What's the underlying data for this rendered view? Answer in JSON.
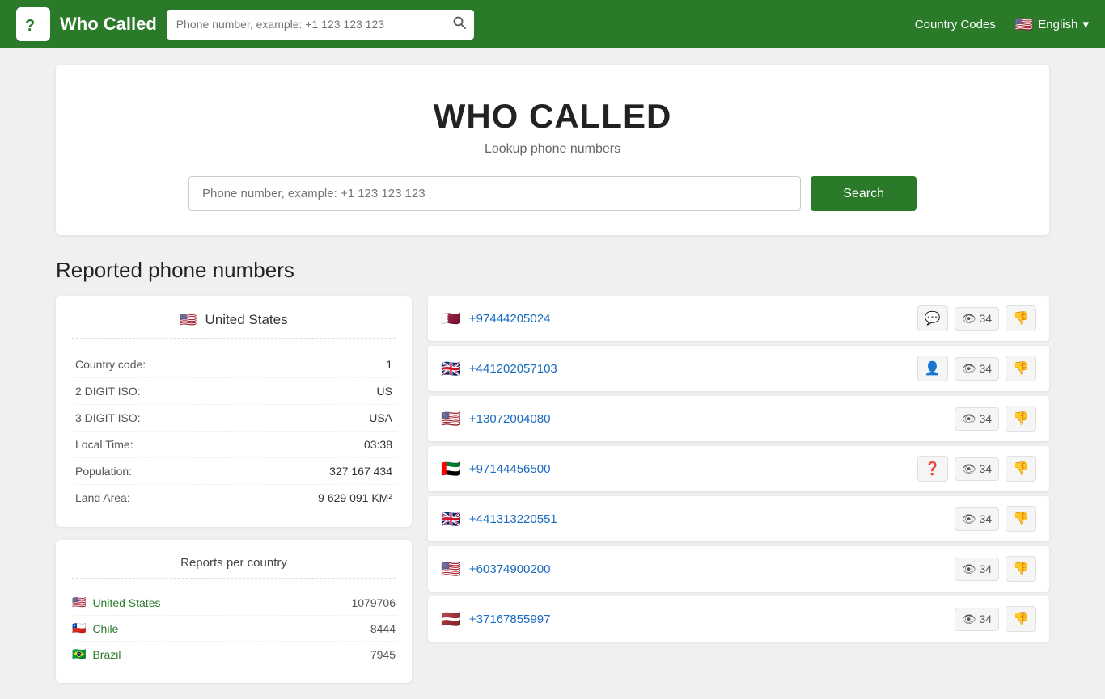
{
  "site": {
    "name": "Who Called",
    "logo_symbol": "?",
    "tagline": "Lookup phone numbers"
  },
  "navbar": {
    "search_placeholder": "Phone number, example: +1 123 123 123",
    "country_codes_label": "Country Codes",
    "language_label": "English",
    "language_flag": "🇺🇸"
  },
  "hero": {
    "title": "WHO CALLED",
    "subtitle": "Lookup phone numbers",
    "search_placeholder": "Phone number, example: +1 123 123 123",
    "search_button": "Search"
  },
  "section": {
    "reported_title": "Reported phone numbers"
  },
  "country_info": {
    "name": "United States",
    "flag": "🇺🇸",
    "country_code_label": "Country code:",
    "country_code_value": "1",
    "iso2_label": "2 DIGIT ISO:",
    "iso2_value": "US",
    "iso3_label": "3 DIGIT ISO:",
    "iso3_value": "USA",
    "local_time_label": "Local Time:",
    "local_time_value": "03:38",
    "population_label": "Population:",
    "population_value": "327 167 434",
    "land_area_label": "Land Area:",
    "land_area_value": "9 629 091 KM²"
  },
  "reports_per_country": {
    "title": "Reports per country",
    "items": [
      {
        "flag": "🇺🇸",
        "name": "United States",
        "count": "1079706"
      },
      {
        "flag": "🇨🇱",
        "name": "Chile",
        "count": "8444"
      },
      {
        "flag": "🇧🇷",
        "name": "Brazil",
        "count": "7945"
      }
    ]
  },
  "phone_numbers": [
    {
      "flag": "🇶🇦",
      "number": "+97444205024",
      "views": 34,
      "has_chat": true,
      "has_person": false,
      "has_question": false
    },
    {
      "flag": "🇬🇧",
      "number": "+441202057103",
      "views": 34,
      "has_chat": false,
      "has_person": true,
      "has_question": false
    },
    {
      "flag": "🇺🇸",
      "number": "+13072004080",
      "views": 34,
      "has_chat": false,
      "has_person": false,
      "has_question": false
    },
    {
      "flag": "🇦🇪",
      "number": "+97144456500",
      "views": 34,
      "has_chat": false,
      "has_person": false,
      "has_question": true
    },
    {
      "flag": "🇬🇧",
      "number": "+441313220551",
      "views": 34,
      "has_chat": false,
      "has_person": false,
      "has_question": false
    },
    {
      "flag": "🇺🇸",
      "number": "+60374900200",
      "views": 34,
      "has_chat": false,
      "has_person": false,
      "has_question": false
    },
    {
      "flag": "🇱🇻",
      "number": "+37167855997",
      "views": 34,
      "has_chat": false,
      "has_person": false,
      "has_question": false
    }
  ]
}
